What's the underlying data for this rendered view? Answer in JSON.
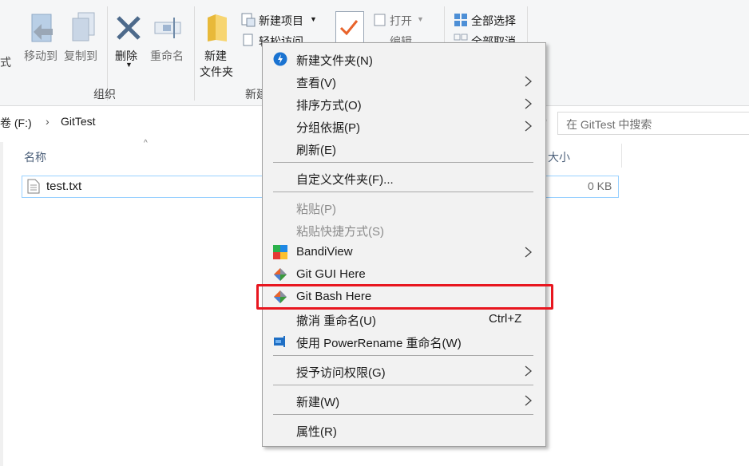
{
  "ribbon": {
    "partial_left": "式",
    "move_to": "移动到",
    "copy_to": "复制到",
    "delete": "删除",
    "rename": "重命名",
    "group_organize": "组织",
    "new_folder_l1": "新建",
    "new_folder_l2": "文件夹",
    "new_item": "新建项目",
    "easy_access": "轻松访问",
    "group_new_partial": "新建",
    "open": "打开",
    "edit_partial": "编辑",
    "select_all": "全部选择",
    "select_none": "全部取消"
  },
  "address": {
    "drive": "卷 (F:)",
    "folder": "GitTest",
    "search_placeholder": "在 GitTest 中搜索"
  },
  "list": {
    "col_name": "名称",
    "col_size": "大小",
    "file_name": "test.txt",
    "file_size": "0 KB"
  },
  "menu": {
    "new_folder": "新建文件夹(N)",
    "view": "查看(V)",
    "sort_by": "排序方式(O)",
    "group_by": "分组依据(P)",
    "refresh": "刷新(E)",
    "customize": "自定义文件夹(F)...",
    "paste": "粘贴(P)",
    "paste_shortcut": "粘贴快捷方式(S)",
    "bandiview": "BandiView",
    "git_gui": "Git GUI Here",
    "git_bash": "Git Bash Here",
    "undo_rename": "撤消 重命名(U)",
    "undo_shortcut": "Ctrl+Z",
    "powerrename": "使用 PowerRename 重命名(W)",
    "grant_access": "授予访问权限(G)",
    "new": "新建(W)",
    "properties": "属性(R)"
  },
  "colors": {
    "highlight_border": "#e8161f",
    "menu_bg": "#f2f2f2",
    "selection_border": "#99d1ff"
  }
}
